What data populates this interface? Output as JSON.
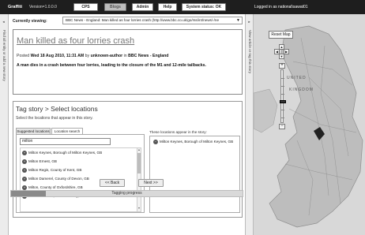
{
  "topbar": {
    "brand": "Graffiti",
    "version": "Version=1.0.0.0",
    "buttons": [
      {
        "label": "CPS",
        "active": true
      },
      {
        "label": "Blogs",
        "active": false
      },
      {
        "label": "Admin",
        "active": true
      },
      {
        "label": "Help",
        "active": true
      },
      {
        "label": "System status: OK",
        "active": true
      }
    ],
    "login": "Logged in as national\\sawat01"
  },
  "left_strip": {
    "label": "Find all entity or add a new story"
  },
  "right_strip": {
    "label": "View article or tag this story"
  },
  "viewing": {
    "label": "Currently viewing:",
    "value": "BBC News - England: Man killed as four lorries crash (http://www.bbc.co.uk/go/rss/int/news/-/ne",
    "arrow": "▼"
  },
  "article": {
    "title": "Man killed as four lorries crash",
    "posted_label": "Posted",
    "posted_date": "Wed 18 Aug 2010, 11:31 AM",
    "by_label": "by",
    "author": "unknown-author",
    "in_label": "in",
    "source": "BBC News - England",
    "summary": "A man dies in a crash between four lorries, leading to the closure of the M1 and 12-mile tailbacks."
  },
  "tagging": {
    "breadcrumb": "Tag story > Select locations",
    "instruction": "Select the locations that appear in this story.",
    "tabs": [
      {
        "label": "Suggested locations",
        "selected": false
      },
      {
        "label": "Location search",
        "selected": true
      }
    ],
    "query": "milton",
    "results": [
      "Milton Keynes, Borough of Milton Keynes, GB",
      "Milton Ernest, GB",
      "Milton Regis, County of Kent, GB",
      "Milton Damerel, County of Devon, GB",
      "Milton, County of Oxfordshire, GB",
      "Milton of Murtle, Aberdeen City, GB"
    ],
    "appear_label": "These locations appear in the story:",
    "appear_items": [
      "Milton Keynes, Borough of Milton Keynes, GB"
    ],
    "back_label": "<< Back",
    "next_label": "Next >>",
    "progress_label": "Tagging progress",
    "progress_fraction": 0.15
  },
  "map": {
    "reset_label": "Reset Map",
    "labels": [
      "UNITED",
      "KINGDOM"
    ],
    "zoom_level_fraction": 0.62
  },
  "colors": {
    "topbar": "#1e1e1e",
    "panel_border": "#999999",
    "map_land": "#bdbdbd",
    "map_sea": "#d8d8d8"
  }
}
